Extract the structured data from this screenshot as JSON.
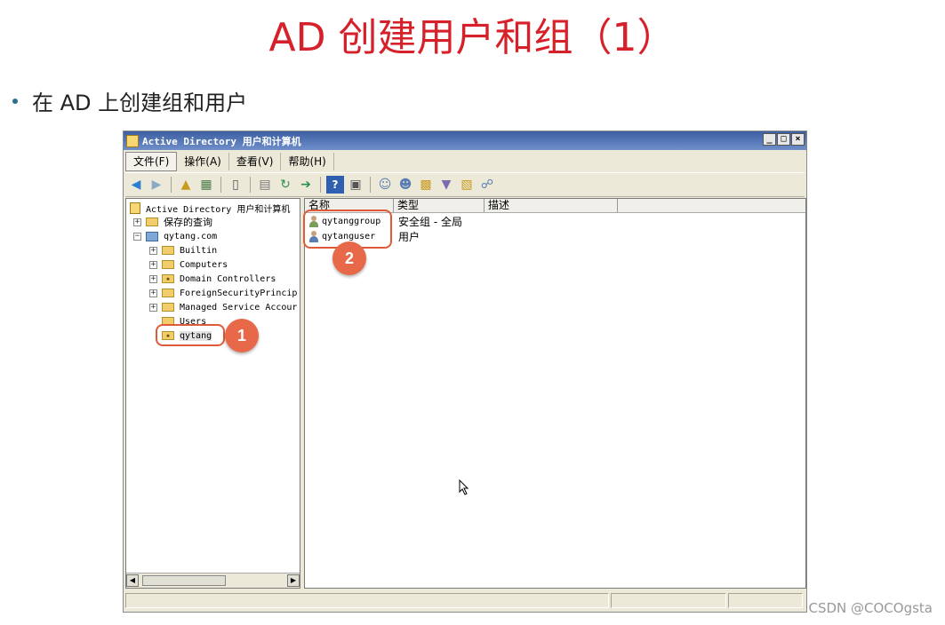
{
  "slide": {
    "title": "AD 创建用户和组（1）",
    "bullet": "在 AD 上创建组和用户"
  },
  "window": {
    "title": "Active Directory 用户和计算机",
    "controls": [
      "_",
      "□",
      "×"
    ],
    "menu": [
      "文件(F)",
      "操作(A)",
      "查看(V)",
      "帮助(H)"
    ]
  },
  "tree": {
    "root": "Active Directory 用户和计算机",
    "saved_queries": "保存的查询",
    "domain": "qytang.com",
    "children": [
      "Builtin",
      "Computers",
      "Domain Controllers",
      "ForeignSecurityPrincip",
      "Managed Service Accour",
      "Users",
      "qytang"
    ]
  },
  "list": {
    "columns": [
      "名称",
      "类型",
      "描述"
    ],
    "rows": [
      {
        "name": "qytanggroup",
        "type": "安全组 - 全局",
        "icon": "group-icon"
      },
      {
        "name": "qytanguser",
        "type": "用户",
        "icon": "user-icon"
      }
    ]
  },
  "callouts": [
    "1",
    "2"
  ],
  "watermark": "CSDN @COCOgsta",
  "colors": {
    "title_red": "#d6202a",
    "callout": "#e8694a",
    "titlebar": "#3d5fa3"
  }
}
